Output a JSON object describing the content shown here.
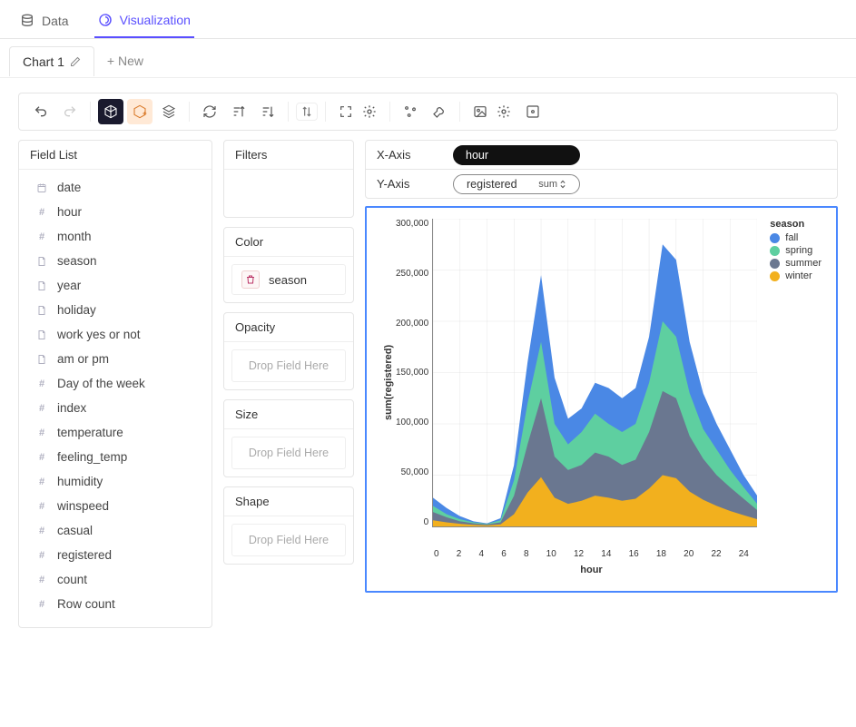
{
  "nav": {
    "data_tab": "Data",
    "viz_tab": "Visualization"
  },
  "chartTabs": {
    "current": "Chart 1",
    "new_label": "+ New"
  },
  "fieldList": {
    "title": "Field List",
    "items": [
      {
        "name": "date",
        "type": "date"
      },
      {
        "name": "hour",
        "type": "number"
      },
      {
        "name": "month",
        "type": "number"
      },
      {
        "name": "season",
        "type": "text"
      },
      {
        "name": "year",
        "type": "text"
      },
      {
        "name": "holiday",
        "type": "text"
      },
      {
        "name": "work yes or not",
        "type": "text"
      },
      {
        "name": "am or pm",
        "type": "text"
      },
      {
        "name": "Day of the week",
        "type": "number"
      },
      {
        "name": "index",
        "type": "number"
      },
      {
        "name": "temperature",
        "type": "number"
      },
      {
        "name": "feeling_temp",
        "type": "number"
      },
      {
        "name": "humidity",
        "type": "number"
      },
      {
        "name": "winspeed",
        "type": "number"
      },
      {
        "name": "casual",
        "type": "number"
      },
      {
        "name": "registered",
        "type": "number"
      },
      {
        "name": "count",
        "type": "number"
      },
      {
        "name": "Row count",
        "type": "number"
      }
    ]
  },
  "shelves": {
    "filters_title": "Filters",
    "color_title": "Color",
    "color_value": "season",
    "opacity_title": "Opacity",
    "size_title": "Size",
    "shape_title": "Shape",
    "drop_placeholder": "Drop Field Here"
  },
  "axes": {
    "x_title": "X-Axis",
    "x_value": "hour",
    "y_title": "Y-Axis",
    "y_value": "registered",
    "y_agg": "sum"
  },
  "chart_data": {
    "type": "area",
    "stacked": true,
    "xlabel": "hour",
    "ylabel": "sum(registered)",
    "x": [
      0,
      1,
      2,
      3,
      4,
      5,
      6,
      7,
      8,
      9,
      10,
      11,
      12,
      13,
      14,
      15,
      16,
      17,
      18,
      19,
      20,
      21,
      22,
      23,
      24
    ],
    "x_ticks": [
      0,
      2,
      4,
      6,
      8,
      10,
      12,
      14,
      16,
      18,
      20,
      22,
      24
    ],
    "ylim": [
      0,
      300000
    ],
    "y_ticks": [
      0,
      50000,
      100000,
      150000,
      200000,
      250000,
      300000
    ],
    "y_tick_labels": [
      "0",
      "50,000",
      "100,000",
      "150,000",
      "200,000",
      "250,000",
      "300,000"
    ],
    "legend_title": "season",
    "series": [
      {
        "name": "fall",
        "color": "#4a88e5",
        "values": [
          28000,
          18000,
          10000,
          5000,
          3000,
          8000,
          60000,
          160000,
          245000,
          145000,
          105000,
          115000,
          140000,
          135000,
          125000,
          135000,
          185000,
          275000,
          260000,
          180000,
          130000,
          100000,
          75000,
          50000,
          30000
        ]
      },
      {
        "name": "spring",
        "color": "#5ecfa0",
        "values": [
          20000,
          12000,
          7000,
          4000,
          2500,
          6000,
          45000,
          120000,
          180000,
          100000,
          80000,
          92000,
          110000,
          100000,
          92000,
          100000,
          140000,
          200000,
          185000,
          130000,
          95000,
          75000,
          55000,
          38000,
          22000
        ]
      },
      {
        "name": "summer",
        "color": "#6a7790",
        "values": [
          14000,
          9000,
          5000,
          3000,
          2000,
          4000,
          30000,
          80000,
          125000,
          68000,
          55000,
          60000,
          72000,
          68000,
          60000,
          65000,
          92000,
          132000,
          125000,
          88000,
          66000,
          50000,
          38000,
          27000,
          16000
        ]
      },
      {
        "name": "winter",
        "color": "#f2b01e",
        "values": [
          6000,
          4000,
          2500,
          1500,
          1000,
          2000,
          12000,
          33000,
          48000,
          28000,
          22000,
          25000,
          30000,
          28000,
          25000,
          27000,
          37000,
          50000,
          47000,
          34000,
          26000,
          20000,
          15000,
          11000,
          7000
        ]
      }
    ]
  }
}
